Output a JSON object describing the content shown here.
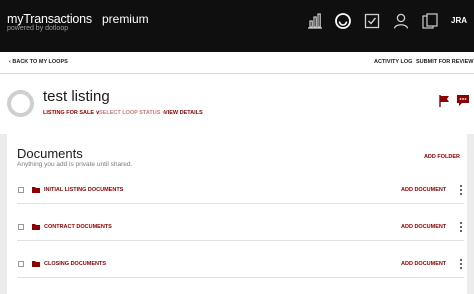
{
  "brand": {
    "name": "myTransactions",
    "tier": "premium",
    "powered_by": "powered by dotloop"
  },
  "header": {
    "icons": [
      "bar-chart-icon",
      "loop-icon",
      "task-check-icon",
      "person-icon",
      "documents-icon"
    ],
    "user_initials": "JRA"
  },
  "subnav": {
    "back_label": "BACK TO MY LOOPS",
    "activity_log": "ACTIVITY LOG",
    "submit_review": "SUBMIT FOR REVIEW"
  },
  "loop": {
    "title": "test listing",
    "transaction_type": "LISTING FOR SALE",
    "status_placeholder": "SELECT LOOP STATUS",
    "view_details": "VIEW DETAILS"
  },
  "documents": {
    "title": "Documents",
    "subtitle": "Anything you add is private until shared.",
    "add_folder": "ADD FOLDER",
    "add_document_label": "ADD DOCUMENT",
    "folders": [
      {
        "name": "INITIAL LISTING DOCUMENTS"
      },
      {
        "name": "CONTRACT DOCUMENTS"
      },
      {
        "name": "CLOSING DOCUMENTS"
      }
    ]
  },
  "colors": {
    "accent": "#8b0000",
    "topbar": "#0f0f0f",
    "background": "#ececec"
  }
}
